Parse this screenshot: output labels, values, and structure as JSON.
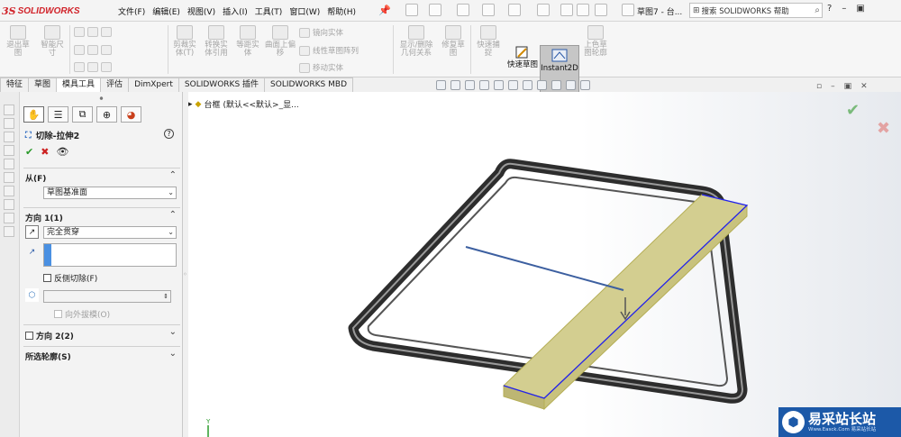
{
  "app": {
    "logo_mark": "3S",
    "logo_text": "SOLIDWORKS",
    "doc_title": "草图7 - 台..."
  },
  "menu": [
    "文件(F)",
    "编辑(E)",
    "视图(V)",
    "插入(I)",
    "工具(T)",
    "窗口(W)",
    "帮助(H)"
  ],
  "search": {
    "placeholder": "搜索 SOLIDWORKS 帮助"
  },
  "commands": {
    "exit_sketch": "退出草图",
    "smart_dim": "智能尺寸",
    "trim": "剪裁实体(T)",
    "convert": "转换实体引用",
    "offset": "等距实体",
    "surface_offset": "曲面上偏移",
    "mirror": "镜向实体",
    "linear_pattern": "线性草图阵列",
    "move": "移动实体",
    "show_relations": "显示/删除几何关系",
    "repair": "修复草图",
    "quick_snap": "快速捕捉",
    "quick_sketch": "快速草图",
    "instant2d": "Instant2D",
    "shaded_contours": "上色草图轮廓"
  },
  "tabs": [
    "特征",
    "草图",
    "模具工具",
    "评估",
    "DimXpert",
    "SOLIDWORKS 插件",
    "SOLIDWORKS MBD"
  ],
  "active_tab": "模具工具",
  "property_manager": {
    "feature_name": "切除-拉伸2",
    "from": {
      "label": "从(F)",
      "value": "草图基准面"
    },
    "direction1": {
      "label": "方向 1(1)",
      "end_condition": "完全贯穿",
      "flip_side": "反侧切除(F)",
      "draft_outward": "向外拔模(O)"
    },
    "direction2": {
      "label": "方向 2(2)"
    },
    "selected_contours": {
      "label": "所选轮廓(S)"
    }
  },
  "feature_tree": {
    "root": "台框",
    "config": "(默认<<默认>_显..."
  },
  "triad": {
    "y": "Y"
  },
  "watermark": {
    "title": "易采站长站",
    "subtitle": "Www.Easck.Com  易采站长站"
  },
  "colors": {
    "accent": "#1c59a8",
    "extrude_fill": "#cfc98a",
    "extrude_edge": "#1c1cff",
    "frame": "#3a3a3a"
  }
}
